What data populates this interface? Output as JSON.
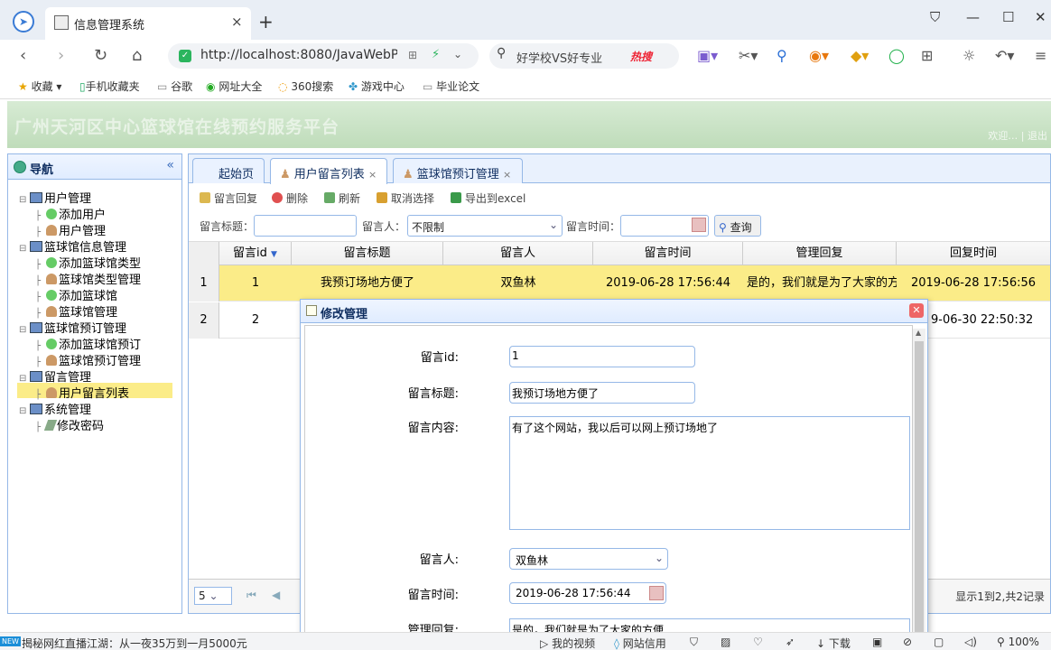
{
  "browser": {
    "tab_title": "信息管理系统",
    "tab_close": "×",
    "new_tab": "+",
    "url": "http://localhost:8080/JavaWebPr",
    "search_text": "好学校VS好专业",
    "search_hot": "热搜",
    "bookmarks": [
      "收藏",
      "手机收藏夹",
      "谷歌",
      "网址大全",
      "360搜索",
      "游戏中心",
      "毕业论文"
    ]
  },
  "app": {
    "title": "广州天河区中心篮球馆在线预约服务平台",
    "header_right": "欢迎… | 退出"
  },
  "nav": {
    "title": "导航",
    "collapse": "«",
    "groups": [
      {
        "label": "用户管理",
        "items": [
          {
            "label": "添加用户",
            "icon": "plus"
          },
          {
            "label": "用户管理",
            "icon": "user"
          }
        ]
      },
      {
        "label": "篮球馆信息管理",
        "items": [
          {
            "label": "添加篮球馆类型",
            "icon": "plus"
          },
          {
            "label": "篮球馆类型管理",
            "icon": "user"
          },
          {
            "label": "添加篮球馆",
            "icon": "plus"
          },
          {
            "label": "篮球馆管理",
            "icon": "user"
          }
        ]
      },
      {
        "label": "篮球馆预订管理",
        "items": [
          {
            "label": "添加篮球馆预订",
            "icon": "plus"
          },
          {
            "label": "篮球馆预订管理",
            "icon": "user"
          }
        ]
      },
      {
        "label": "留言管理",
        "items": [
          {
            "label": "用户留言列表",
            "icon": "user"
          }
        ]
      },
      {
        "label": "系统管理",
        "items": [
          {
            "label": "修改密码",
            "icon": "pen"
          }
        ]
      }
    ]
  },
  "tabs": [
    {
      "label": "起始页",
      "closable": false
    },
    {
      "label": "用户留言列表",
      "closable": true,
      "active": true
    },
    {
      "label": "篮球馆预订管理",
      "closable": true
    }
  ],
  "toolbar": {
    "reply": "留言回复",
    "delete": "删除",
    "refresh": "刷新",
    "unselect": "取消选择",
    "export": "导出到excel"
  },
  "filters": {
    "title_label": "留言标题：",
    "user_label": "留言人：",
    "user_value": "不限制",
    "time_label": "留言时间：",
    "query": "查询"
  },
  "grid": {
    "columns": [
      "留言id",
      "留言标题",
      "留言人",
      "留言时间",
      "管理回复",
      "回复时间"
    ],
    "rows": [
      {
        "num": "1",
        "id": "1",
        "title": "我预订场地方便了",
        "user": "双鱼林",
        "time": "2019-06-28 17:56:44",
        "reply": "是的，我们就是为了大家的方",
        "reply_time": "2019-06-28 17:56:56"
      },
      {
        "num": "2",
        "id": "2",
        "title": "",
        "user": "",
        "time": "",
        "reply": "",
        "reply_time": "9-06-30 22:50:32"
      }
    ],
    "page_size": "5",
    "page_info": "显示1到2,共2记录"
  },
  "dialog": {
    "title": "修改管理",
    "close": "✕",
    "id_label": "留言id:",
    "id_value": "1",
    "title_label": "留言标题:",
    "title_value": "我预订场地方便了",
    "content_label": "留言内容:",
    "content_value": "有了这个网站，我以后可以网上预订场地了",
    "user_label": "留言人:",
    "user_value": "双鱼林",
    "time_label": "留言时间:",
    "time_value": "2019-06-28 17:56:44",
    "reply_label": "管理回复:",
    "reply_value": "是的，我们就是为了大家的方便"
  },
  "status": {
    "news": "揭秘网红直播江湖：从一夜35万到一月5000元",
    "my_video": "我的视频",
    "site_trust": "网站信用",
    "download": "下载",
    "zoom": "100%"
  }
}
